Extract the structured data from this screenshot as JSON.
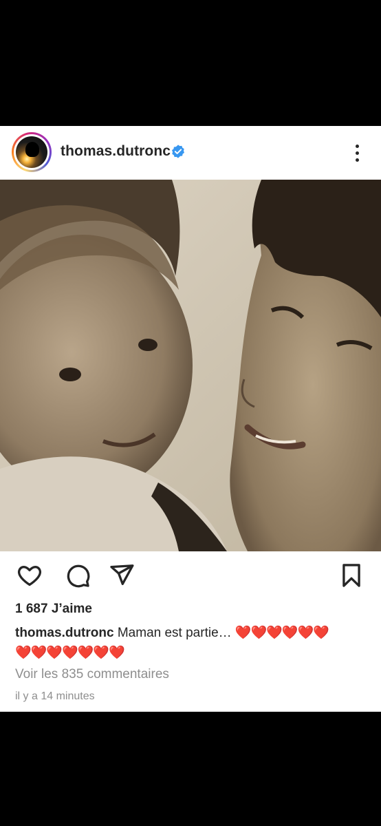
{
  "post": {
    "username": "thomas.dutronc",
    "verified": true,
    "likes_text": "1 687 J’aime",
    "caption_user": "thomas.dutronc",
    "caption_text": "Maman est partie… ",
    "caption_hearts_line1": "❤️❤️❤️❤️❤️❤️",
    "caption_hearts_line2": "❤️❤️❤️❤️❤️❤️❤️",
    "view_comments": "Voir les 835 commentaires",
    "timestamp": "il y a 14 minutes"
  },
  "icons": {
    "like": "heart-outline-icon",
    "comment": "comment-bubble-icon",
    "share": "paper-plane-icon",
    "save": "bookmark-icon",
    "more": "three-dots-vertical-icon",
    "verified": "verified-badge-icon"
  },
  "colors": {
    "text": "#262626",
    "muted": "#8e8e8e",
    "verified_blue": "#3897f0",
    "heart_red": "#e0112b"
  }
}
